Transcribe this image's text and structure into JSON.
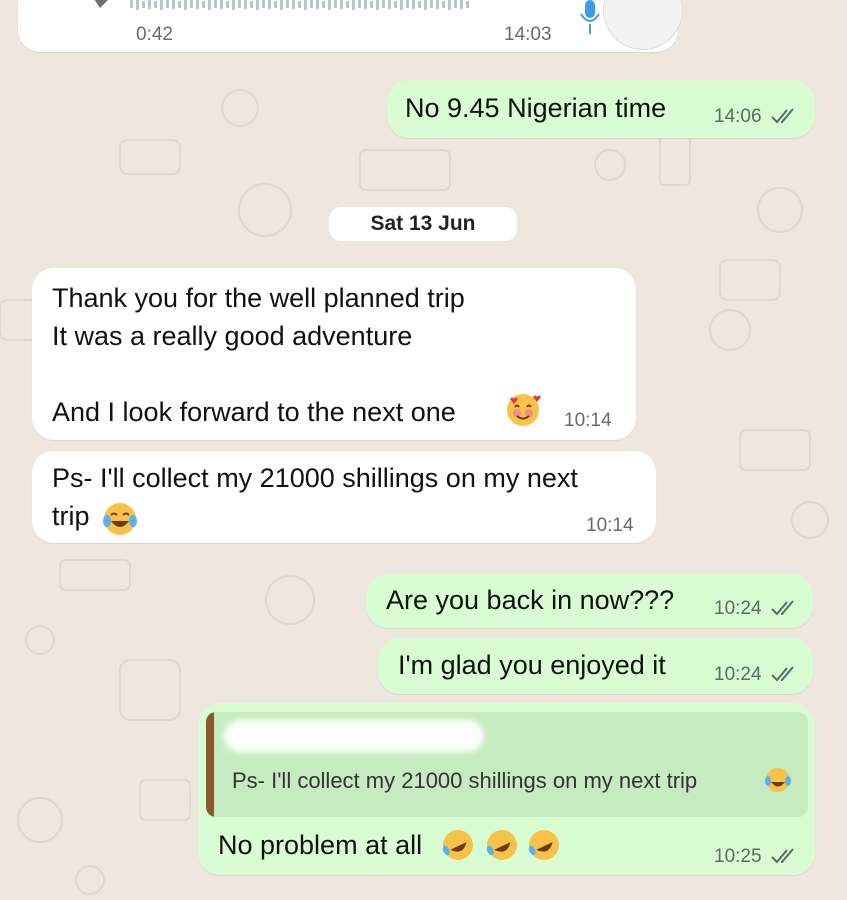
{
  "audio": {
    "duration": "0:42",
    "time": "14:03"
  },
  "messages": [
    {
      "id": "m1",
      "text": "No 9.45 Nigerian time",
      "time": "14:06"
    },
    {
      "id": "m2",
      "text": "Thank you for the well planned trip\nIt was a really good adventure\n\nAnd I look forward to the next one",
      "time": "10:14"
    },
    {
      "id": "m3",
      "text": "Ps- I'll collect my 21000 shillings on my next\ntrip",
      "time": "10:14"
    },
    {
      "id": "m4",
      "text": "Are you back in now???",
      "time": "10:24"
    },
    {
      "id": "m5",
      "text": "I'm glad you enjoyed it",
      "time": "10:24"
    },
    {
      "id": "m6",
      "quoted": "Ps- I'll collect my 21000 shillings on my next trip",
      "text": "No problem at all",
      "time": "10:25"
    }
  ],
  "date_separator": "Sat 13 Jun",
  "icons": {
    "read_receipt": "double-check-icon",
    "mic": "microphone-icon",
    "smiling_hearts": "smiling-face-with-hearts-emoji",
    "tears_of_joy": "face-with-tears-of-joy-emoji",
    "rofl": "rolling-on-floor-laughing-emoji"
  },
  "colors": {
    "background": "#efe7dd",
    "incoming": "#ffffff",
    "outgoing": "#d9fdd3",
    "quote_bar": "#8b5a2b"
  }
}
